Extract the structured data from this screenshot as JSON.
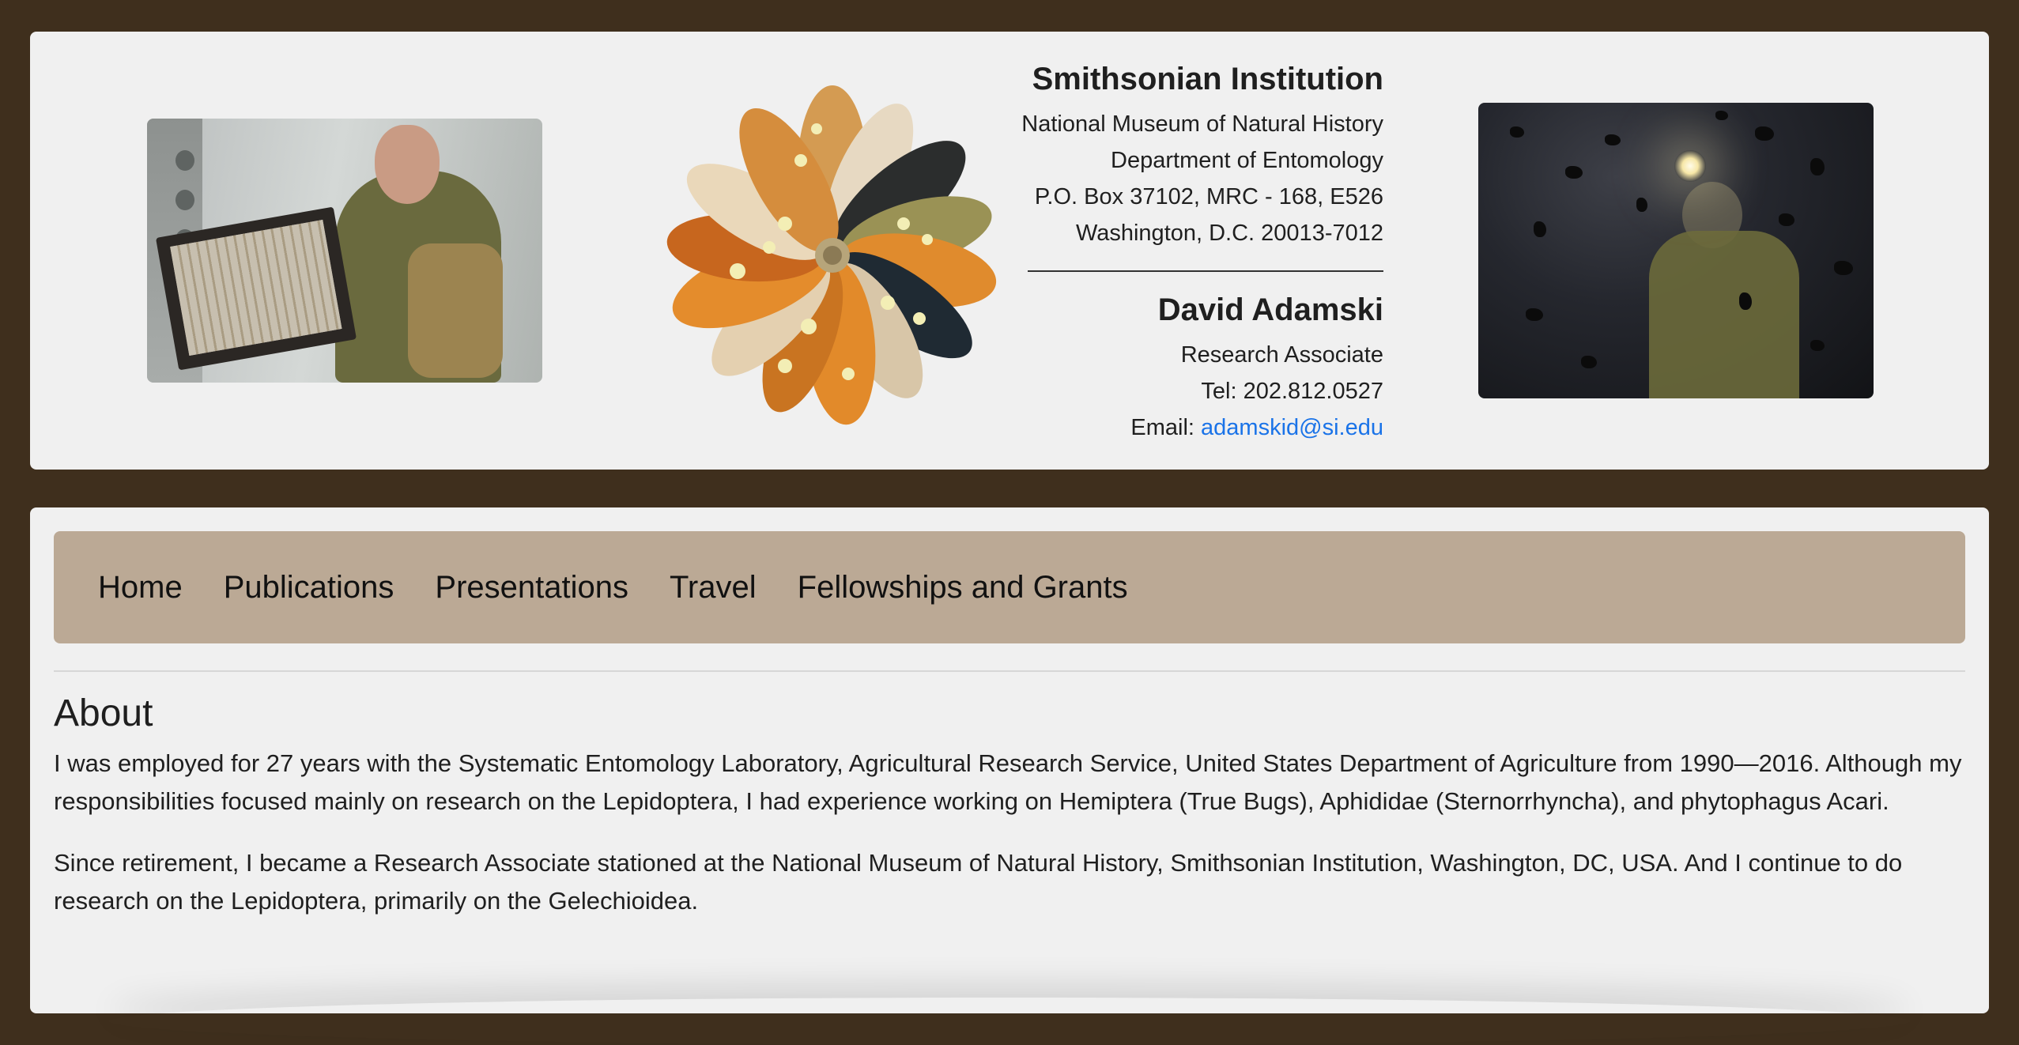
{
  "header": {
    "institution": "Smithsonian Institution",
    "address_lines": [
      "National Museum of Natural History",
      "Department of Entomology",
      "P.O. Box 37102, MRC - 168, E526",
      "Washington, D.C. 20013-7012"
    ],
    "person_name": "David Adamski",
    "role": "Research Associate",
    "tel": "Tel: 202.812.0527",
    "email_label": "Email: ",
    "email": "adamskid@si.edu",
    "photos": {
      "left": "researcher-with-specimen-drawer-photo",
      "center": "butterfly-wing-rosette-logo",
      "right": "researcher-with-headlamp-and-moths-photo"
    }
  },
  "nav": {
    "items": [
      "Home",
      "Publications",
      "Presentations",
      "Travel",
      "Fellowships and Grants"
    ]
  },
  "about": {
    "heading": "About",
    "paragraphs": [
      "I was employed for 27 years with the Systematic Entomology Laboratory, Agricultural Research Service, United States Department of Agriculture from 1990—2016. Although my responsibilities focused mainly on research on the Lepidoptera, I had experience working on Hemiptera (True Bugs), Aphididae (Sternorrhyncha), and phytophagus Acari.",
      "Since retirement, I became a Research Associate stationed at the National Museum of Natural History, Smithsonian Institution, Washington, DC, USA. And I continue to do research on the Lepidoptera, primarily on the Gelechioidea."
    ]
  },
  "colors": {
    "page_background": "#3f2f1d",
    "card_background": "#f0f0f0",
    "nav_background": "#bba995",
    "link": "#1a73e8"
  }
}
